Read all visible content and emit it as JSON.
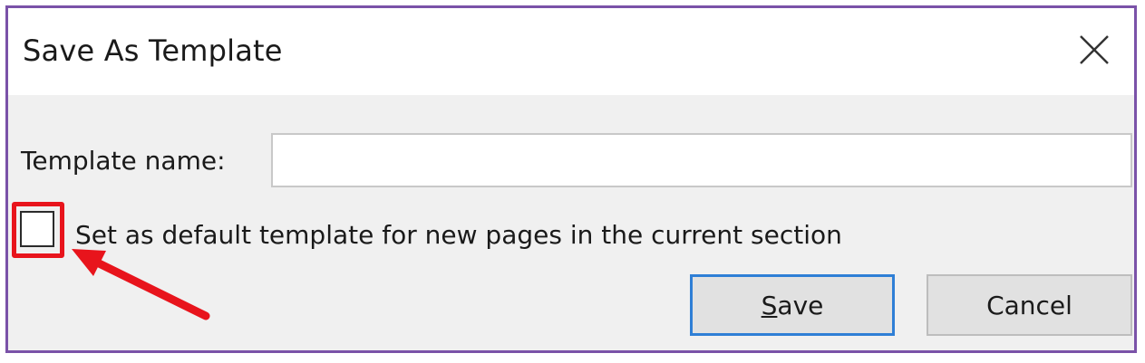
{
  "dialog": {
    "title": "Save As Template",
    "close_icon": "close-icon"
  },
  "form": {
    "template_name_label": "Template name:",
    "template_name_value": "",
    "default_checkbox_label": "Set as default template for new pages in the current section",
    "default_checkbox_checked": false
  },
  "buttons": {
    "save_accel": "S",
    "save_rest": "ave",
    "cancel_label": "Cancel"
  },
  "colors": {
    "dialog_border": "#7a52a8",
    "highlight_annotation": "#e8141c",
    "default_button_border": "#2f7fd6"
  }
}
